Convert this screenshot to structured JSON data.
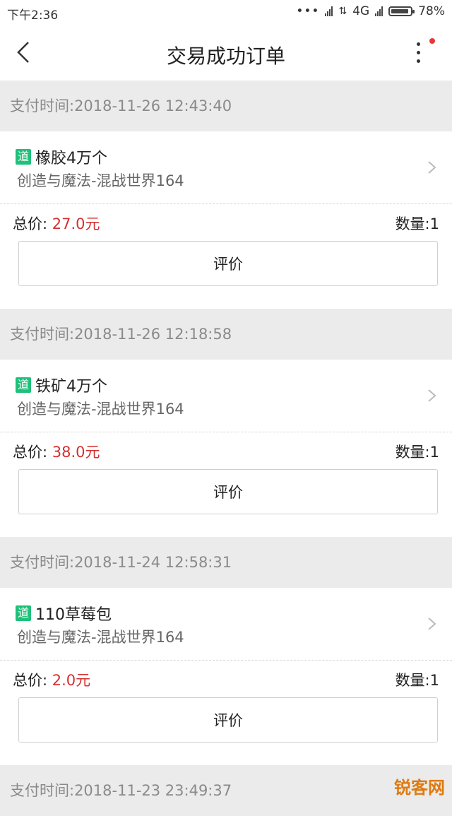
{
  "status_bar": {
    "time": "下午2:36",
    "network": "4G",
    "battery": "78%"
  },
  "header": {
    "title": "交易成功订单"
  },
  "orders": [
    {
      "pay_time": "支付时间:2018-11-26 12:43:40",
      "tag": "道",
      "item_name": "橡胶4万个",
      "server": "创造与魔法-混战世界164",
      "total_label": "总价: ",
      "price": "27.0元",
      "quantity": "数量:1",
      "rate_label": "评价"
    },
    {
      "pay_time": "支付时间:2018-11-26 12:18:58",
      "tag": "道",
      "item_name": "铁矿4万个",
      "server": "创造与魔法-混战世界164",
      "total_label": "总价: ",
      "price": "38.0元",
      "quantity": "数量:1",
      "rate_label": "评价"
    },
    {
      "pay_time": "支付时间:2018-11-24 12:58:31",
      "tag": "道",
      "item_name": "110草莓包",
      "server": "创造与魔法-混战世界164",
      "total_label": "总价: ",
      "price": "2.0元",
      "quantity": "数量:1",
      "rate_label": "评价"
    }
  ],
  "next_pay_time": "支付时间:2018-11-23 23:49:37",
  "watermark": {
    "text": "锐客网"
  }
}
